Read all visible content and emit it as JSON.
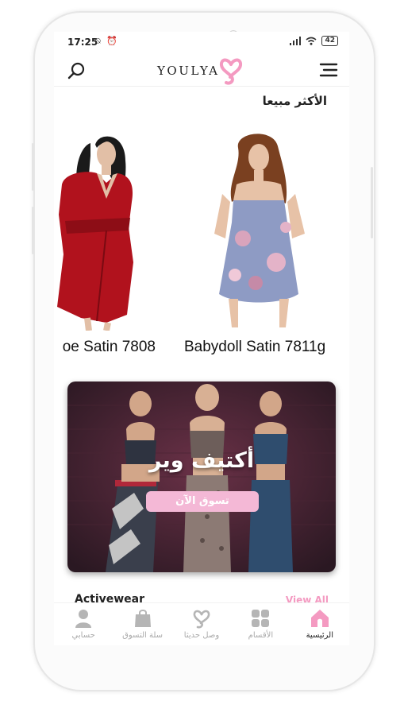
{
  "status_bar": {
    "time": "17:25",
    "battery": "42"
  },
  "header": {
    "brand": "YOULYA"
  },
  "best_sellers": {
    "title": "الأكثر مبيعا",
    "products": [
      {
        "name": "Babydoll Satin 7811g"
      },
      {
        "name": "oe Satin 7808"
      }
    ]
  },
  "banner": {
    "title": "أكتيف وير",
    "button": "تسوق الآن"
  },
  "activewear": {
    "title": "Activewear",
    "view_all": "View All"
  },
  "bottom_nav": {
    "items": [
      {
        "label": "الرئيسية",
        "icon": "home-icon",
        "active": true
      },
      {
        "label": "الأقسام",
        "icon": "categories-icon",
        "active": false
      },
      {
        "label": "وصل حديثا",
        "icon": "heart-logo-icon",
        "active": false
      },
      {
        "label": "سلة التسوق",
        "icon": "shopping-bag-icon",
        "active": false
      },
      {
        "label": "حسابي",
        "icon": "user-icon",
        "active": false
      }
    ]
  },
  "colors": {
    "brand_pink": "#f49ac1",
    "button_pink": "#f4b8d6",
    "text": "#222222",
    "muted": "#aaaaaa"
  }
}
